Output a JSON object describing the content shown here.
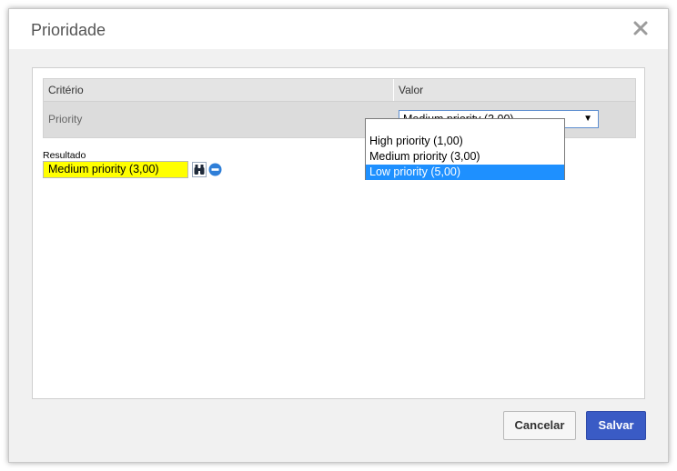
{
  "dialog": {
    "title": "Prioridade",
    "close_icon": "close-icon"
  },
  "grid": {
    "columns": [
      "Critério",
      "Valor"
    ],
    "row": {
      "label": "Priority",
      "selected_value": "Medium priority (3,00)"
    }
  },
  "dropdown": {
    "options": [
      "High priority (1,00)",
      "Medium priority (3,00)",
      "Low priority (5,00)"
    ],
    "highlighted_index": 2,
    "highlight_color": "#1e90ff"
  },
  "result": {
    "label": "Resultado",
    "value": "Medium priority (3,00)",
    "value_background": "#ffff00",
    "search_icon": "binoculars-icon",
    "clear_icon": "minus-circle-icon"
  },
  "buttons": {
    "cancel": "Cancelar",
    "save": "Salvar",
    "save_color": "#3a5bc5"
  }
}
